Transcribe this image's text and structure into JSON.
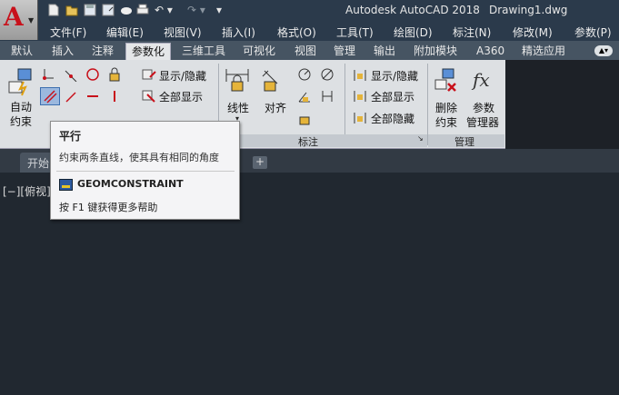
{
  "titlebar": {
    "app_name": "Autodesk AutoCAD 2018",
    "document": "Drawing1.dwg",
    "right_menu": "参数(P)"
  },
  "menu": [
    "文件(F)",
    "编辑(E)",
    "视图(V)",
    "插入(I)",
    "格式(O)",
    "工具(T)",
    "绘图(D)",
    "标注(N)",
    "修改(M)"
  ],
  "ribbon_tabs": [
    "默认",
    "插入",
    "注释",
    "参数化",
    "三维工具",
    "可视化",
    "视图",
    "管理",
    "输出",
    "附加模块",
    "A360",
    "精选应用"
  ],
  "ribbon": {
    "auto_constraint_label_1": "自动",
    "auto_constraint_label_2": "约束",
    "show_hide": "显示/隐藏",
    "show_all": "全部显示",
    "hide_all": "全部隐藏",
    "linear": "线性",
    "aligned": "对齐",
    "dim_show_hide": "显示/隐藏",
    "dim_show_all": "全部显示",
    "dim_hide_all": "全部隐藏",
    "delete_constraint_1": "删除",
    "delete_constraint_2": "约束",
    "param_manager_1": "参数",
    "param_manager_2": "管理器",
    "fx_glyph": "fx",
    "panel_dimension": "标注",
    "panel_manage": "管理"
  },
  "file_tabs": {
    "start": "开始",
    "add": "+"
  },
  "viewport": {
    "label": "[−][俯视][二"
  },
  "tooltip": {
    "title": "平行",
    "description": "约束两条直线，使其具有相同的角度",
    "command": "GEOMCONSTRAINT",
    "help": "按 F1 键获得更多帮助"
  },
  "colors": {
    "accent_red": "#c8111b",
    "canvas": "#212830",
    "ribbon": "#dde0e3"
  }
}
